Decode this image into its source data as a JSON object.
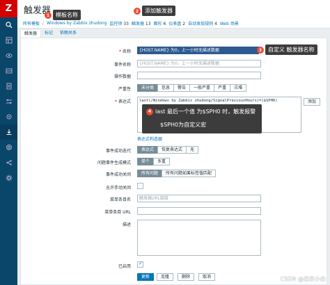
{
  "app": {
    "logo": "Z",
    "page_title": "触发器"
  },
  "sidebar": {
    "icons": [
      "search-icon",
      "dashboard-icon",
      "monitoring-icon",
      "inventory-icon",
      "reports-icon",
      "configuration-icon",
      "administration-icon",
      "support-icon",
      "share-icon",
      "help-icon",
      "user-icon"
    ]
  },
  "breadcrumb": {
    "all_templates": "所有模板",
    "template": "Windows by Zabbix zhudong",
    "items": [
      {
        "label": "监控项",
        "count": "33"
      },
      {
        "label": "触发器",
        "count": "13"
      },
      {
        "label": "图形",
        "count": "6"
      },
      {
        "label": "仪表盘",
        "count": "2"
      },
      {
        "label": "自动发现规则",
        "count": "4"
      },
      {
        "label": "Web 场景",
        "count": ""
      }
    ]
  },
  "tabs": [
    "触发器",
    "标记",
    "依赖关系"
  ],
  "form": {
    "name_label": "名称",
    "name_value": "{HOST.NAME} 为0，上一小时无描述数据",
    "event_name_label": "事件名称",
    "event_name_placeholder": "{HOST.NAME} 为0，上一小时无描述数据",
    "opdata_label": "操作数据",
    "severity_label": "严重性",
    "severity_options": [
      "未分类",
      "信息",
      "警告",
      "一般严重",
      "严重",
      "灾难"
    ],
    "expression_label": "表达式",
    "expression_value": "last(/Windows by Zabbix zhudong/SignalPreviousHours)=($SPH0)",
    "add_button": "添加",
    "expr_builder_link": "表达式构造器",
    "ok_event_label": "事件成功迭代",
    "ok_event_options": [
      "表达式",
      "恢复表达式",
      "无"
    ],
    "problem_mode_label": "问题事件生成模式",
    "problem_mode_options": [
      "单个",
      "多重"
    ],
    "ok_close_label": "事件成功关闭",
    "ok_close_options": [
      "所有问题",
      "所有问题如果标签值匹配"
    ],
    "manual_close_label": "允许手动关闭",
    "menu_name_label": "菜单条目名",
    "menu_name_placeholder": "触发器URL链接",
    "menu_url_label": "菜单条目 URL",
    "description_label": "描述",
    "enabled_label": "已启用"
  },
  "buttons": {
    "update": "更新",
    "clone": "克隆",
    "delete": "删除",
    "cancel": "取消"
  },
  "annotations": {
    "a1": {
      "num": "1",
      "text": "模板名称"
    },
    "a2": {
      "num": "2",
      "text": "添加触发器"
    },
    "a3": {
      "num": "3",
      "text": "自定义 触发器名称"
    },
    "a4": {
      "num": "4",
      "line1": "last  最后一个值 为$SPH0 时，触发报警",
      "line2": "$SPH0为自定义宏"
    }
  },
  "watermark": "CSDN @出示小白"
}
